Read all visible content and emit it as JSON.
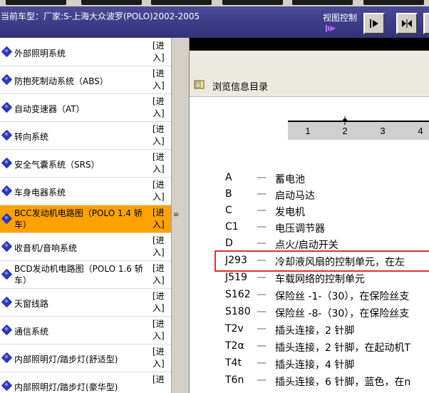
{
  "header": {
    "vehicle_info": "当前车型：厂家:S-上海大众波罗(POLO)2002-2005",
    "view_control_label": "视图控制"
  },
  "icons": {
    "view_glyph": "signal-arrow-icon",
    "btn_next": "play-icon",
    "btn_split": "split-icon",
    "browse": "folder-book-icon"
  },
  "colors": {
    "header_bg": "#3b3b87",
    "selected_row": "#ffa200",
    "diamond": "#2b38b5",
    "highlight_box": "#e03030"
  },
  "systems": [
    {
      "label": "外部照明系统",
      "link": "[进入]"
    },
    {
      "label": "防抱死制动系统（ABS）",
      "link": "[进入]"
    },
    {
      "label": "自动变速器（AT）",
      "link": "[进入]"
    },
    {
      "label": "转向系统",
      "link": "[进入]"
    },
    {
      "label": "安全气囊系统（SRS）",
      "link": "[进入]"
    },
    {
      "label": "车身电器系统",
      "link": "[进入]"
    },
    {
      "label": "BCC发动机电路图（POLO 1.4 轿车）",
      "link": "[进入]",
      "selected": true
    },
    {
      "label": "收音机/音响系统",
      "link": "[进入]"
    },
    {
      "label": "BCD发动机电路图（POLO 1.6 轿车）",
      "link": "[进入]"
    },
    {
      "label": "天窗线路",
      "link": "[进入]"
    },
    {
      "label": "通信系统",
      "link": "[进入]"
    },
    {
      "label": "内部照明灯/踏步灯(舒适型)",
      "link": "[进入]"
    },
    {
      "label": "内部照明灯/踏步灯(豪华型)",
      "link": "[进"
    }
  ],
  "browse": {
    "title": "浏览信息目录"
  },
  "ruler": {
    "ticks": [
      "1",
      "2",
      "3",
      "4"
    ]
  },
  "legend": [
    {
      "code": "A",
      "desc": "蓄电池"
    },
    {
      "code": "B",
      "desc": "启动马达"
    },
    {
      "code": "C",
      "desc": "发电机"
    },
    {
      "code": "C1",
      "desc": "电压调节器"
    },
    {
      "code": "D",
      "desc": "点火/启动开关"
    },
    {
      "code": "J293",
      "desc": "冷却液风扇的控制单元，在左"
    },
    {
      "code": "J519",
      "desc": "车载网络的控制单元"
    },
    {
      "code": "S162",
      "desc": "保险丝 -1-（30），在保险丝支"
    },
    {
      "code": "S180",
      "desc": "保险丝 -8-（30），在保险丝支"
    },
    {
      "code": "T2v",
      "desc": "插头连接，2 针脚"
    },
    {
      "code": "T2α",
      "desc": "插头连接，2 针脚，在起动机T"
    },
    {
      "code": "T4t",
      "desc": "插头连接，4 针脚"
    },
    {
      "code": "T6n",
      "desc": "插头连接，6 针脚，蓝色，在n"
    }
  ],
  "legend_dash": "—"
}
